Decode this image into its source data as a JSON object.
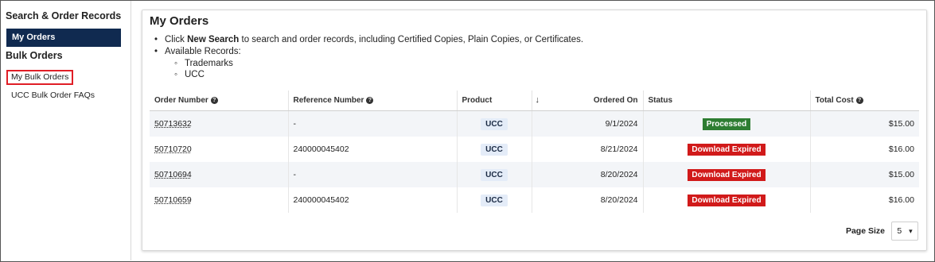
{
  "sidebar": {
    "section1_title": "Search & Order Records",
    "active_item": "My Orders",
    "section2_title": "Bulk Orders",
    "bulk_items": [
      "My Bulk Orders",
      "UCC Bulk Order FAQs"
    ]
  },
  "main": {
    "title": "My Orders",
    "bullet1_pre": "Click ",
    "bullet1_bold": "New Search",
    "bullet1_post": " to search and order records, including Certified Copies, Plain Copies, or Certificates.",
    "bullet2": "Available Records:",
    "records": [
      "Trademarks",
      "UCC"
    ]
  },
  "table": {
    "headers": {
      "order_number": "Order Number",
      "reference_number": "Reference Number",
      "product": "Product",
      "sort_arrow": "↓",
      "ordered_on": "Ordered On",
      "status": "Status",
      "total_cost": "Total Cost"
    },
    "rows": [
      {
        "order": "50713632",
        "reference": "-",
        "product": "UCC",
        "ordered_on": "9/1/2024",
        "status": "Processed",
        "status_color": "#2e7d32",
        "cost": "$15.00"
      },
      {
        "order": "50710720",
        "reference": "240000045402",
        "product": "UCC",
        "ordered_on": "8/21/2024",
        "status": "Download Expired",
        "status_color": "#d11a1a",
        "cost": "$16.00"
      },
      {
        "order": "50710694",
        "reference": "-",
        "product": "UCC",
        "ordered_on": "8/20/2024",
        "status": "Download Expired",
        "status_color": "#d11a1a",
        "cost": "$15.00"
      },
      {
        "order": "50710659",
        "reference": "240000045402",
        "product": "UCC",
        "ordered_on": "8/20/2024",
        "status": "Download Expired",
        "status_color": "#d11a1a",
        "cost": "$16.00"
      }
    ]
  },
  "pager": {
    "label": "Page Size",
    "value": "5",
    "caret": "▾"
  },
  "colors": {
    "sidebar_active_bg": "#102a50",
    "highlight_border": "#e01e26",
    "processed": "#2e7d32",
    "expired": "#d11a1a"
  }
}
